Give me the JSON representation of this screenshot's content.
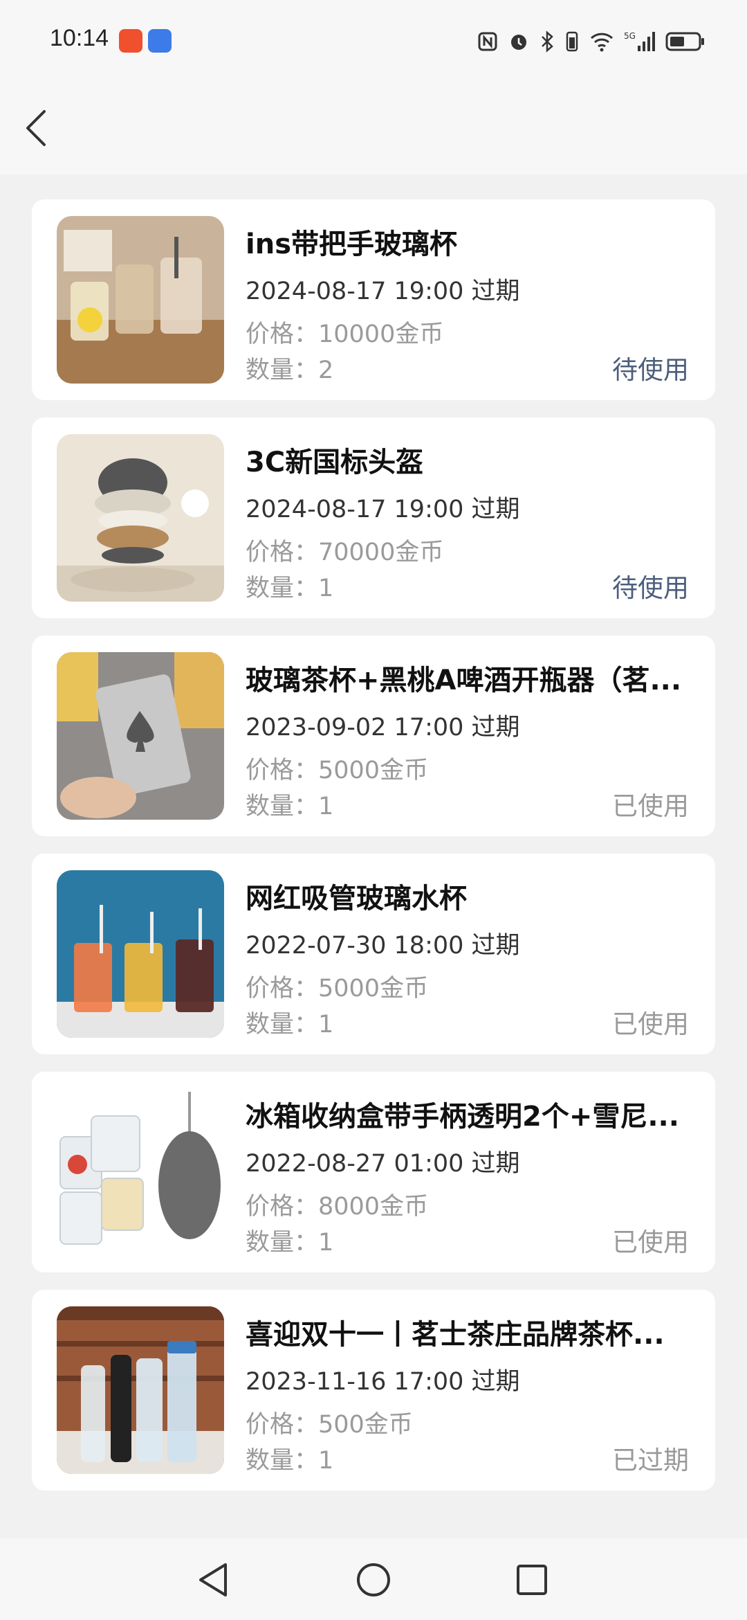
{
  "status_bar": {
    "time": "10:14",
    "app_icons": [
      "taobao-icon",
      "app-icon"
    ],
    "network": "5G"
  },
  "header": {
    "back_icon": "chevron-left-icon"
  },
  "items": [
    {
      "title": "ins带把手玻璃杯",
      "expiry": "2024-08-17 19:00 过期",
      "price": "价格：10000金币",
      "qty": "数量：2",
      "status": "待使用",
      "status_type": "pending"
    },
    {
      "title": "3C新国标头盔",
      "expiry": "2024-08-17 19:00 过期",
      "price": "价格：70000金币",
      "qty": "数量：1",
      "status": "待使用",
      "status_type": "pending"
    },
    {
      "title": "玻璃茶杯+黑桃A啤酒开瓶器（茗...",
      "expiry": "2023-09-02 17:00 过期",
      "price": "价格：5000金币",
      "qty": "数量：1",
      "status": "已使用",
      "status_type": "done"
    },
    {
      "title": "网红吸管玻璃水杯",
      "expiry": "2022-07-30 18:00 过期",
      "price": "价格：5000金币",
      "qty": "数量：1",
      "status": "已使用",
      "status_type": "done"
    },
    {
      "title": "冰箱收纳盒带手柄透明2个+雪尼...",
      "expiry": "2022-08-27 01:00 过期",
      "price": "价格：8000金币",
      "qty": "数量：1",
      "status": "已使用",
      "status_type": "done"
    },
    {
      "title": "喜迎双十一丨茗士茶庄品牌茶杯...",
      "expiry": "2023-11-16 17:00 过期",
      "price": "价格：500金币",
      "qty": "数量：1",
      "status": "已过期",
      "status_type": "done"
    }
  ],
  "nav_bar": {
    "back": "triangle-back-icon",
    "home": "circle-home-icon",
    "recents": "square-recents-icon"
  },
  "colors": {
    "pending": "#4c5e7c",
    "done": "#999999",
    "background": "#f1f1f1"
  }
}
